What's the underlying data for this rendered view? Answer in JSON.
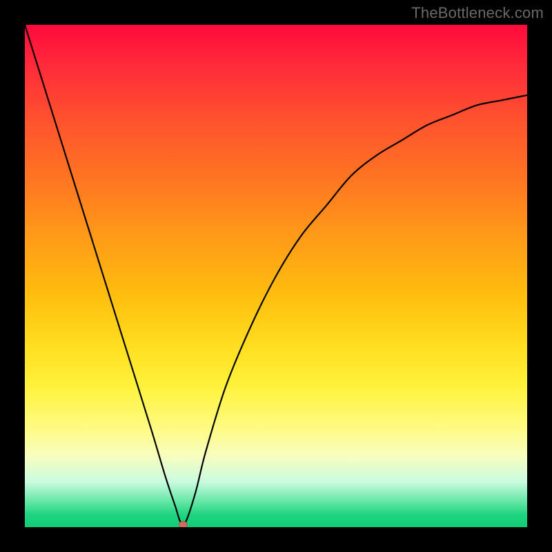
{
  "watermark": "TheBottleneck.com",
  "chart_data": {
    "type": "line",
    "title": "",
    "xlabel": "",
    "ylabel": "",
    "xlim": [
      0,
      100
    ],
    "ylim": [
      0,
      100
    ],
    "grid": false,
    "series": [
      {
        "name": "curve",
        "color": "#000000",
        "x": [
          0,
          5,
          10,
          15,
          20,
          25,
          28,
          30,
          31,
          32,
          34,
          36,
          40,
          45,
          50,
          55,
          60,
          65,
          70,
          75,
          80,
          85,
          90,
          95,
          100
        ],
        "values": [
          100,
          84,
          68,
          52,
          36,
          20,
          10,
          4,
          1,
          1,
          7,
          15,
          28,
          40,
          50,
          58,
          64,
          70,
          74,
          77,
          80,
          82,
          84,
          85,
          86
        ]
      }
    ],
    "marker": {
      "x": 31.5,
      "y": 0.5,
      "color": "#d46a5e",
      "radius_px": 6
    }
  }
}
